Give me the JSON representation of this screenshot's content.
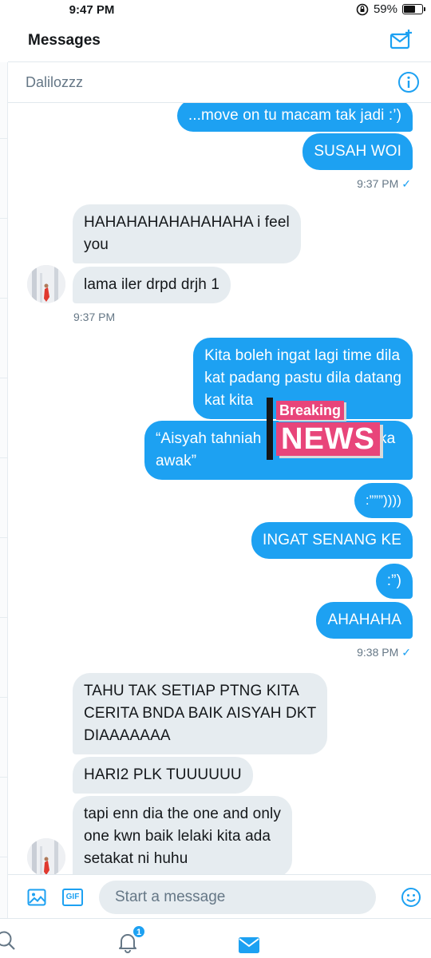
{
  "status_bar": {
    "time": "9:47 PM",
    "battery": "59%"
  },
  "header": {
    "title": "Messages",
    "compose_icon": "new-message-icon"
  },
  "conversation": {
    "title": "Dalilozzz",
    "info_icon": "info-icon"
  },
  "messages": [
    {
      "from": "me",
      "text": "...move on tu macam tak jadi :’)"
    },
    {
      "from": "me",
      "text": "SUSAH WOI"
    },
    {
      "from": "me",
      "text": "9:37 PM",
      "type": "timestamp"
    },
    {
      "from": "them",
      "text": "HAHAHAHAHAHAHAHA i feel\nyou"
    },
    {
      "from": "them",
      "text": "lama iler drpd drjh 1"
    },
    {
      "from": "them",
      "text": "9:37 PM",
      "type": "timestamp"
    },
    {
      "from": "me",
      "text": "Kita boleh ingat lagi time dila\nkat padang pastu dila datang\nkat kita"
    },
    {
      "from": "me",
      "text": "“Aisyah tahniah \n awak”",
      "text_left": "“Aisyah tahniah",
      "text_right": "ka",
      "text_line2": "awak”"
    },
    {
      "from": "me",
      "text": ":”””))))"
    },
    {
      "from": "me",
      "text": "INGAT SENANG KE"
    },
    {
      "from": "me",
      "text": ":”)"
    },
    {
      "from": "me",
      "text": "AHAHAHA"
    },
    {
      "from": "me",
      "text": "9:38 PM",
      "type": "timestamp"
    },
    {
      "from": "them",
      "text": "TAHU TAK SETIAP PTNG KITA\nCERITA BNDA BAIK AISYAH DKT\nDIAAAAAAA"
    },
    {
      "from": "them",
      "text": "HARI2 PLK TUUUUUU"
    },
    {
      "from": "them",
      "text": "tapi enn dia the one and only\none kwn baik lelaki kita ada\nsetakat ni huhu"
    }
  ],
  "sticker": {
    "line1": "Breaking",
    "line2": "NEWS"
  },
  "composer": {
    "placeholder": "Start a message",
    "gif_label": "GIF"
  },
  "tab_bar": {
    "notification_count": "1"
  },
  "colors": {
    "accent": "#1da1f2",
    "incoming_bubble": "#e6ecf0",
    "sticker": "#e8457a"
  }
}
